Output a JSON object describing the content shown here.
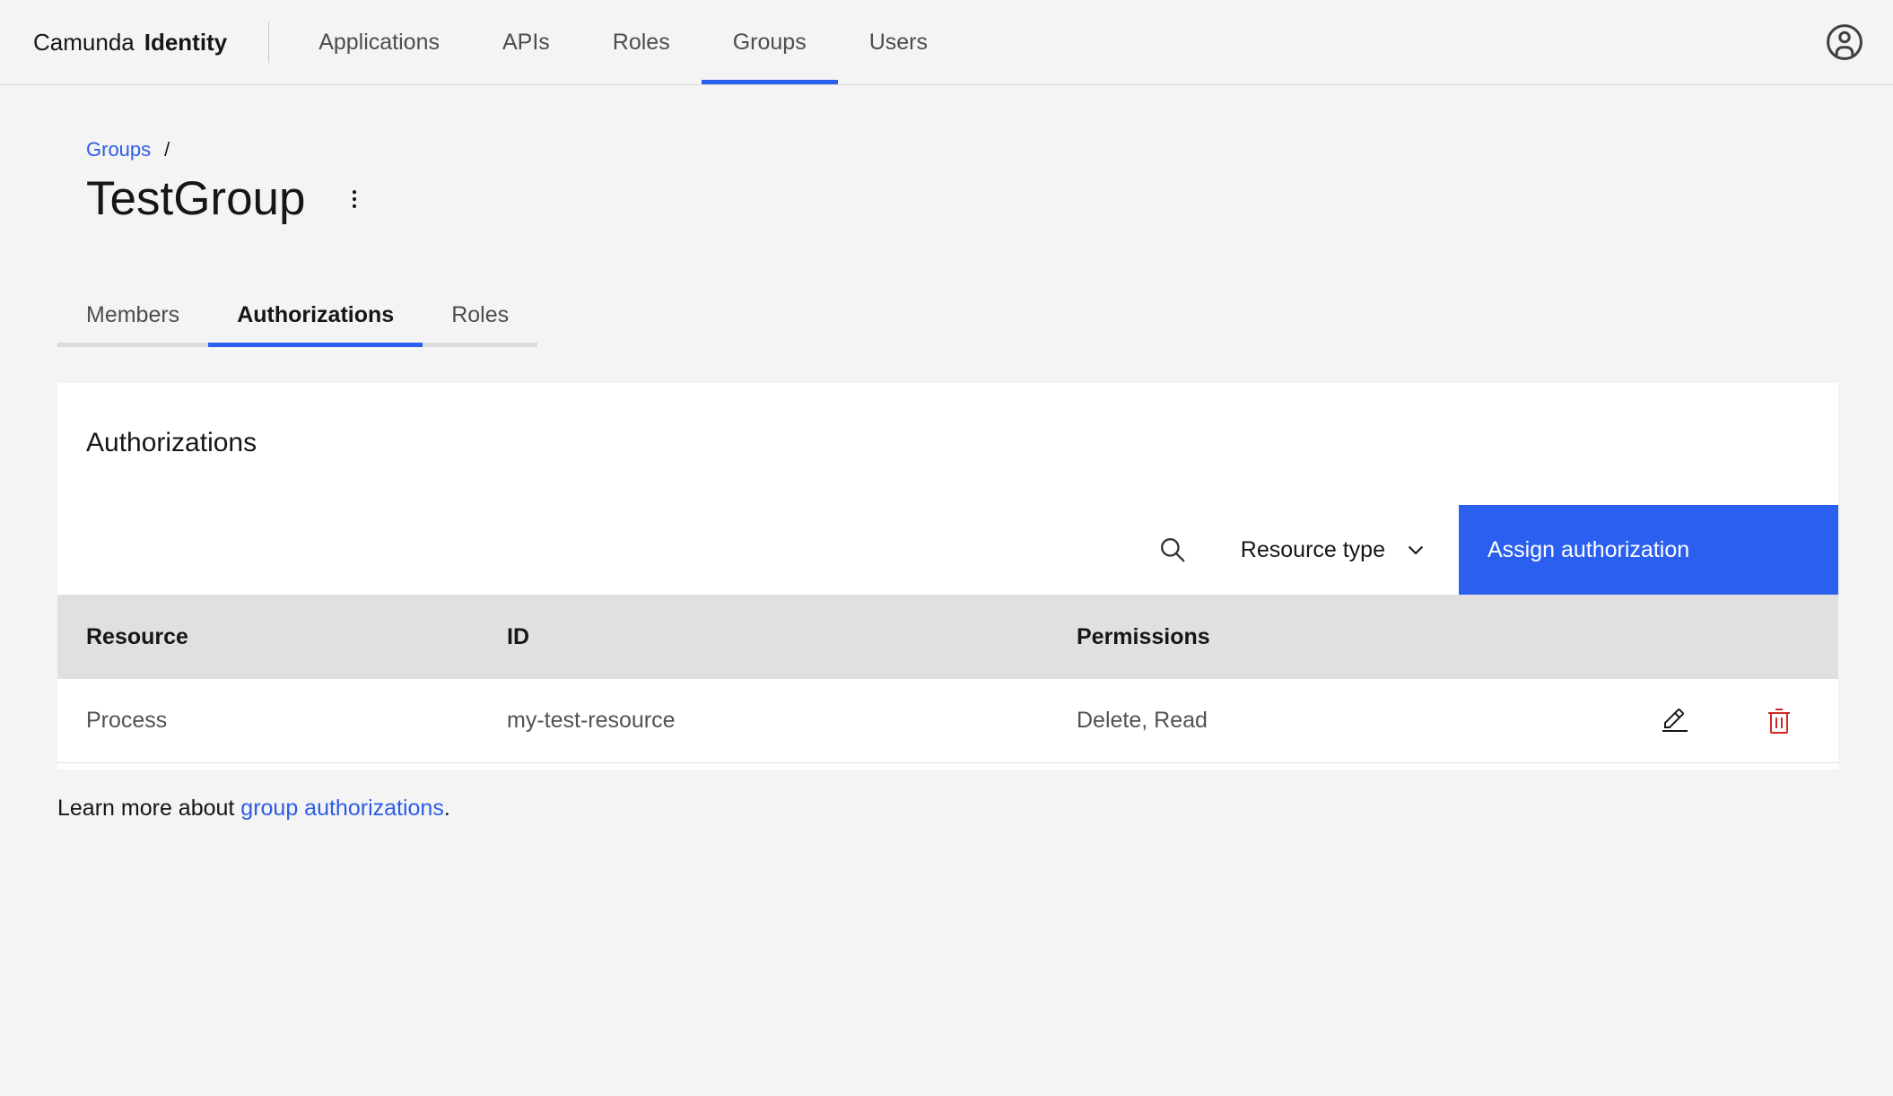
{
  "header": {
    "brand_name": "Camunda",
    "brand_product": "Identity",
    "nav": [
      {
        "label": "Applications",
        "active": false
      },
      {
        "label": "APIs",
        "active": false
      },
      {
        "label": "Roles",
        "active": false
      },
      {
        "label": "Groups",
        "active": true
      },
      {
        "label": "Users",
        "active": false
      }
    ],
    "user_icon": "user-avatar-icon"
  },
  "breadcrumb": {
    "group_link": "Groups",
    "separator": "/"
  },
  "page_title": "TestGroup",
  "tabs": [
    {
      "label": "Members",
      "active": false
    },
    {
      "label": "Authorizations",
      "active": true
    },
    {
      "label": "Roles",
      "active": false
    }
  ],
  "card": {
    "heading": "Authorizations",
    "toolbar": {
      "search_icon": "search-icon",
      "resource_type_label": "Resource type",
      "resource_type_chevron": "chevron-down-icon",
      "assign_button_label": "Assign authorization"
    },
    "table": {
      "columns": [
        "Resource",
        "ID",
        "Permissions"
      ],
      "rows": [
        {
          "resource": "Process",
          "id": "my-test-resource",
          "permissions": "Delete, Read",
          "edit_icon": "edit-icon",
          "delete_icon": "trash-icon"
        }
      ]
    }
  },
  "footer": {
    "prefix": "Learn more about ",
    "link_text": "group authorizations",
    "suffix": "."
  },
  "colors": {
    "accent_blue": "#2a5ff0",
    "link_blue": "#2e5ce6",
    "danger_red": "#d12727",
    "header_bg": "#f4f4f4",
    "table_header_bg": "#e0e0e0"
  }
}
